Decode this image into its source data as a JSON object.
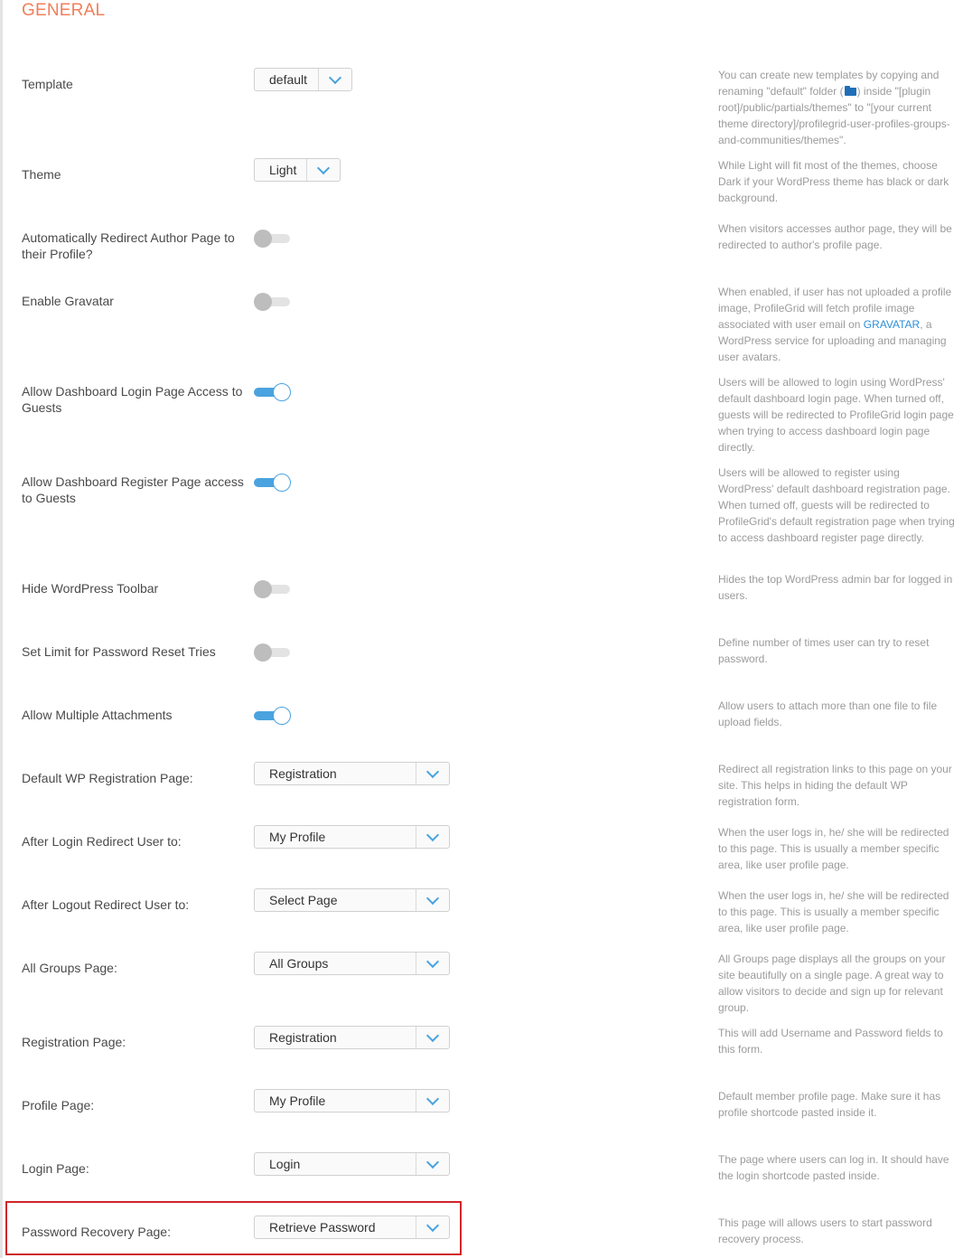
{
  "section": {
    "title": "GENERAL"
  },
  "colors": {
    "accent": "#4aa3df",
    "section_title": "#f07f5a",
    "highlight": "#d0262b",
    "link": "#2e8fd8"
  },
  "settings": [
    {
      "id": "template",
      "label": "Template",
      "control": "select",
      "value": "default",
      "help_parts": [
        "You can create new templates by copying and renaming \"default\" folder (",
        ") inside \"[plugin root]/public/partials/themes\" to \"[your current theme directory]/profilegrid-user-profiles-groups-and-communities/themes\"."
      ],
      "help_icon": "folder-icon"
    },
    {
      "id": "theme",
      "label": "Theme",
      "control": "select",
      "value": "Light",
      "help": "While Light will fit most of the themes, choose Dark if your WordPress theme has black or dark background."
    },
    {
      "id": "author-redirect",
      "label": "Automatically Redirect Author Page to their Profile?",
      "control": "toggle",
      "on": false,
      "help": "When visitors accesses author page, they will be redirected to author's profile page."
    },
    {
      "id": "gravatar",
      "label": "Enable Gravatar",
      "control": "toggle",
      "on": false,
      "help_parts": [
        "When enabled, if user has not uploaded a profile image, ProfileGrid will fetch profile image associated with user email on ",
        "GRAVATAR",
        ", a WordPress service for uploading and managing user avatars."
      ]
    },
    {
      "id": "dashboard-login",
      "label": "Allow Dashboard Login Page Access to Guests",
      "control": "toggle",
      "on": true,
      "help": "Users will be allowed to login using WordPress' default dashboard login page. When turned off, guests will be redirected to ProfileGrid login page when trying to access dashboard login page directly."
    },
    {
      "id": "dashboard-register",
      "label": "Allow Dashboard Register Page access to Guests",
      "control": "toggle",
      "on": true,
      "help": "Users will be allowed to register using WordPress' default dashboard registration page. When turned off, guests will be redirected to ProfileGrid's default registration page when trying to access dashboard register page directly."
    },
    {
      "id": "hide-toolbar",
      "label": "Hide WordPress Toolbar",
      "control": "toggle",
      "on": false,
      "help": "Hides the top WordPress admin bar for logged in users."
    },
    {
      "id": "reset-limit",
      "label": "Set Limit for Password Reset Tries",
      "control": "toggle",
      "on": false,
      "help": "Define number of times user can try to reset password."
    },
    {
      "id": "multi-attach",
      "label": "Allow Multiple Attachments",
      "control": "toggle",
      "on": true,
      "help": "Allow users to attach more than one file to file upload fields."
    },
    {
      "id": "wp-registration",
      "label": "Default WP Registration Page:",
      "control": "select",
      "value": "Registration",
      "help": "Redirect all registration links to this page on your site. This helps in hiding the default WP registration form."
    },
    {
      "id": "login-redirect",
      "label": "After Login Redirect User to:",
      "control": "select",
      "value": "My Profile",
      "help": "When the user logs in, he/ she will be redirected to this page. This is usually a member specific area, like user profile page."
    },
    {
      "id": "logout-redirect",
      "label": "After Logout Redirect User to:",
      "control": "select",
      "value": "Select Page",
      "help": "When the user logs in, he/ she will be redirected to this page. This is usually a member specific area, like user profile page."
    },
    {
      "id": "all-groups",
      "label": "All Groups Page:",
      "control": "select",
      "value": "All Groups",
      "help": "All Groups page displays all the groups on your site beautifully on a single page. A great way to allow visitors to decide and sign up for relevant group."
    },
    {
      "id": "registration",
      "label": "Registration Page:",
      "control": "select",
      "value": "Registration",
      "help": "This will add Username and Password fields to this form."
    },
    {
      "id": "profile",
      "label": "Profile Page:",
      "control": "select",
      "value": "My Profile",
      "help": "Default member profile page. Make sure it has profile shortcode pasted inside it."
    },
    {
      "id": "login",
      "label": "Login Page:",
      "control": "select",
      "value": "Login",
      "help": "The page where users can log in. It should have the login shortcode pasted inside."
    },
    {
      "id": "password-recovery",
      "label": "Password Recovery Page:",
      "control": "select",
      "value": "Retrieve Password",
      "help": "This page will allows users to start password recovery process."
    }
  ]
}
